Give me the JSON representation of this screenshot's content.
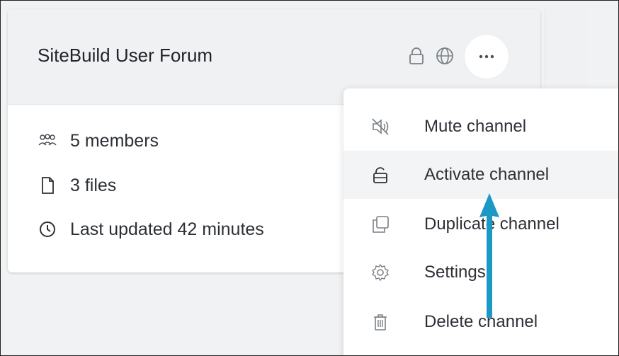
{
  "card": {
    "title": "SiteBuild User Forum",
    "header_icons": [
      "lock-icon",
      "globe-icon"
    ],
    "more_icon": "more-dots-icon",
    "stats": {
      "members": "5 members",
      "files": "3 files",
      "updated": "Last updated 42 minutes"
    }
  },
  "menu": {
    "items": [
      {
        "label": "Mute channel",
        "icon": "mute-icon"
      },
      {
        "label": "Activate channel",
        "icon": "unlock-icon"
      },
      {
        "label": "Duplicate channel",
        "icon": "duplicate-icon"
      },
      {
        "label": "Settings",
        "icon": "gear-icon"
      },
      {
        "label": "Delete channel",
        "icon": "trash-icon"
      }
    ],
    "highlighted": "Activate channel"
  },
  "colors": {
    "background": "#f1f2f4",
    "card_header": "#f0f1f3",
    "text": "#2c3036",
    "icon": "#7b8087",
    "arrow": "#1b98c4",
    "menu_hover": "#f3f4f6"
  }
}
